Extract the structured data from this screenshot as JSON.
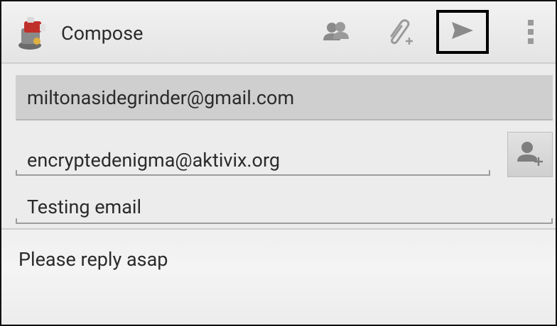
{
  "actionbar": {
    "title": "Compose",
    "icons": {
      "app": "app-logo-icon",
      "contacts": "contacts-icon",
      "attach": "attach-add-icon",
      "send": "send-icon",
      "overflow": "overflow-menu-icon"
    }
  },
  "compose": {
    "from": "miltonasidegrinder@gmail.com",
    "to": "encryptedenigma@aktivix.org",
    "subject": "Testing email",
    "body": "Please reply asap"
  },
  "colors": {
    "text": "#2b2b2b",
    "icon": "#8a8a8a",
    "highlight_border": "#000000"
  }
}
